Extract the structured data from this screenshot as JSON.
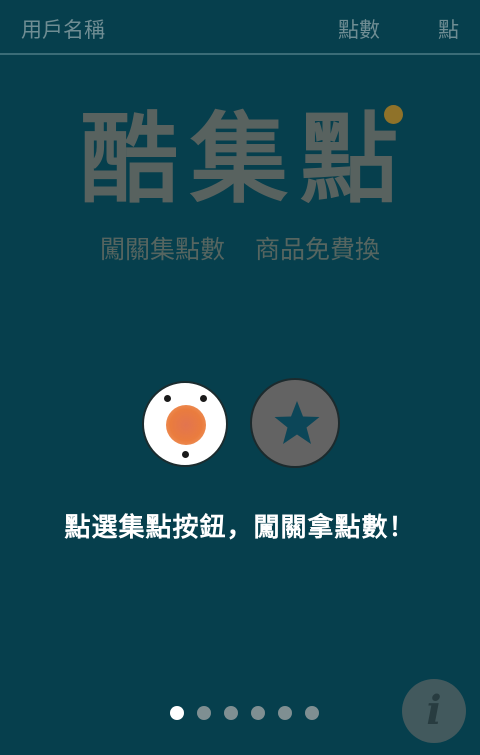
{
  "header": {
    "user_name": "用戶名稱",
    "points_label": "點數",
    "points_value": "點"
  },
  "logo": {
    "title": "酷集點",
    "tagline_part1": "闖關集點數",
    "tagline_part2": "商品免費換"
  },
  "tutorial": {
    "instruction": "點選集點按鈕，闖關拿點數！",
    "collect_button_icon": "collect-target-icon",
    "star_button_icon": "star-icon"
  },
  "pager": {
    "total_pages": 6,
    "current_page": 1
  },
  "info_button": {
    "label": "i"
  },
  "colors": {
    "background": "#063f4d",
    "accent_orange": "#ea7c3e",
    "star_blue": "#0c4658"
  }
}
